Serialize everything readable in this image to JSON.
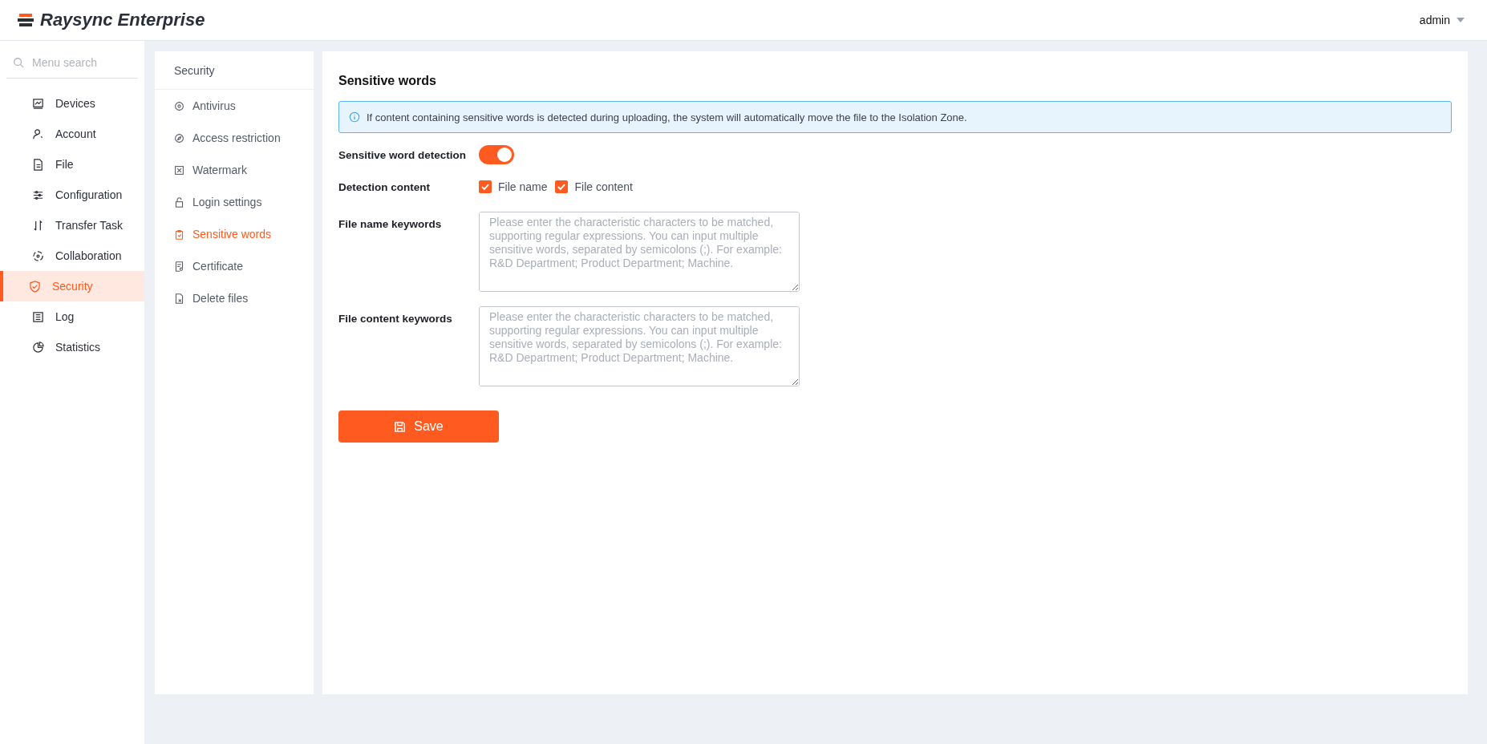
{
  "header": {
    "logo_text": "Raysync Enterprise",
    "user": "admin"
  },
  "sidebar": {
    "search": {
      "placeholder": "Menu search"
    },
    "items": [
      {
        "label": "Devices",
        "selected": false
      },
      {
        "label": "Account",
        "selected": false
      },
      {
        "label": "File",
        "selected": false
      },
      {
        "label": "Configuration",
        "selected": false
      },
      {
        "label": "Transfer Task",
        "selected": false
      },
      {
        "label": "Collaboration",
        "selected": false
      },
      {
        "label": "Security",
        "selected": true
      },
      {
        "label": "Log",
        "selected": false
      },
      {
        "label": "Statistics",
        "selected": false
      }
    ]
  },
  "submenu": {
    "title": "Security",
    "items": [
      {
        "label": "Antivirus",
        "selected": false
      },
      {
        "label": "Access restriction",
        "selected": false
      },
      {
        "label": "Watermark",
        "selected": false
      },
      {
        "label": "Login settings",
        "selected": false
      },
      {
        "label": "Sensitive words",
        "selected": true
      },
      {
        "label": "Certificate",
        "selected": false
      },
      {
        "label": "Delete files",
        "selected": false
      }
    ]
  },
  "content": {
    "title": "Sensitive words",
    "notice": "If content containing sensitive words is detected during uploading, the system will automatically move the file to the Isolation Zone.",
    "detection": {
      "label": "Sensitive word detection",
      "on": true
    },
    "detection_content": {
      "label": "Detection content",
      "options": [
        {
          "label": "File name",
          "checked": true
        },
        {
          "label": "File content",
          "checked": true
        }
      ]
    },
    "fields": [
      {
        "label": "File name keywords",
        "placeholder": "Please enter the characteristic characters to be matched, supporting regular expressions. You can input multiple sensitive words, separated by semicolons (;). For example: R&D Department; Product Department; Machine."
      },
      {
        "label": "File content keywords",
        "placeholder": "Please enter the characteristic characters to be matched, supporting regular expressions. You can input multiple sensitive words, separated by semicolons (;). For example: R&D Department; Product Department; Machine."
      }
    ],
    "save_button": "Save"
  }
}
